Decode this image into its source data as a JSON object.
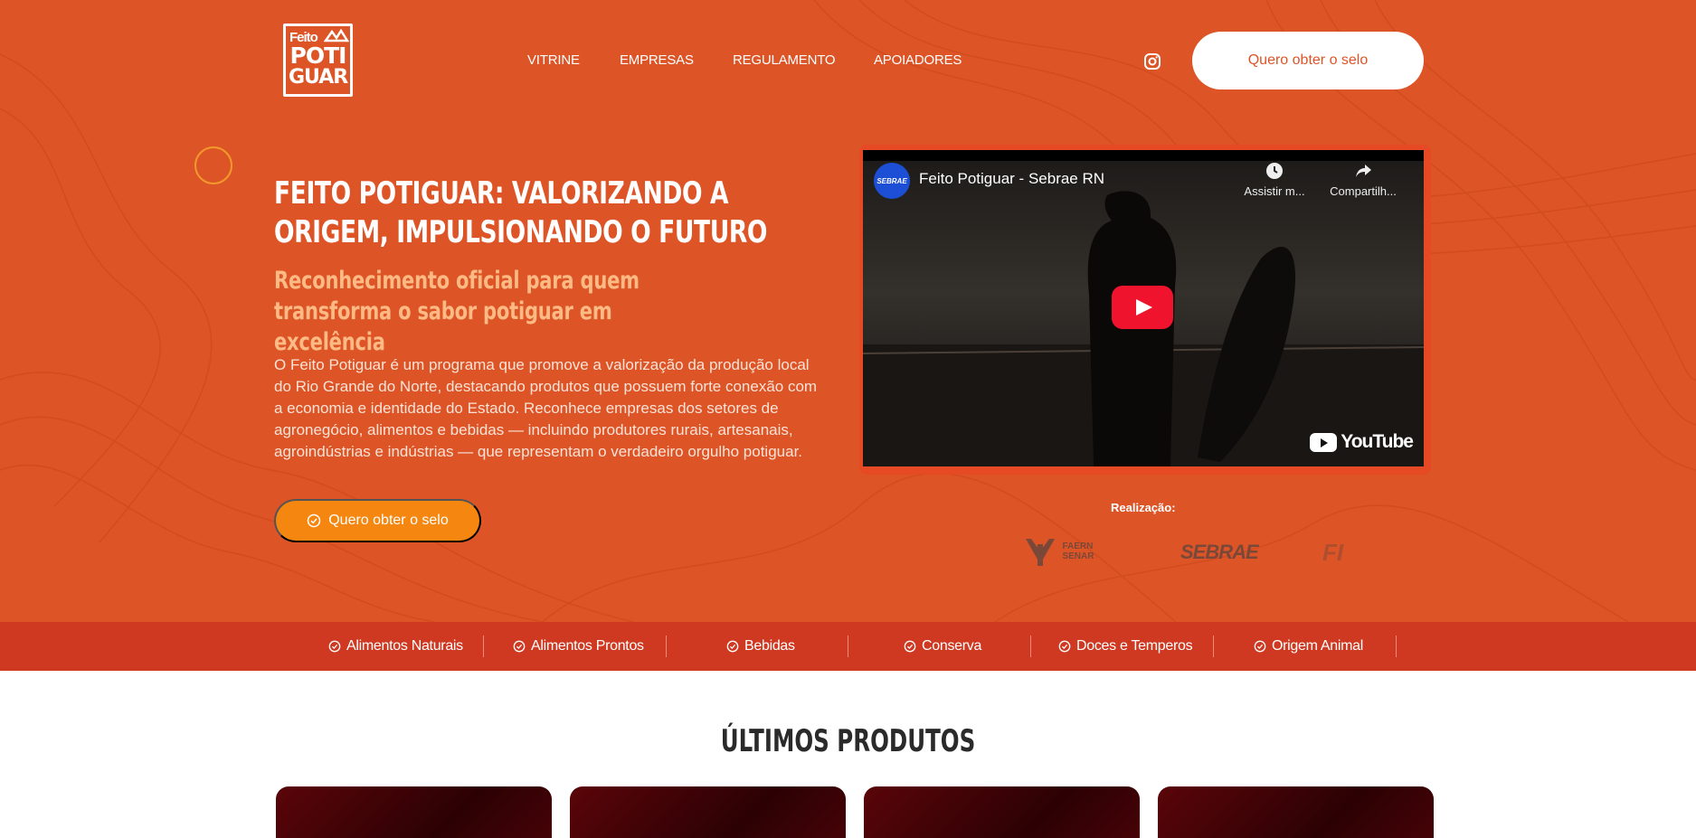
{
  "header": {
    "logo": {
      "line1": "Feito",
      "line2": "POTI",
      "line3": "GUAR"
    },
    "nav": [
      "VITRINE",
      "EMPRESAS",
      "REGULAMENTO",
      "APOIADORES"
    ],
    "cta_label": "Quero obter o selo"
  },
  "hero": {
    "title": "FEITO POTIGUAR: VALORIZANDO A ORIGEM, IMPULSIONANDO O FUTURO",
    "subtitle": "Reconhecimento oficial para quem transforma o sabor potiguar em excelência",
    "description": "O Feito Potiguar é um programa que promove a valorização da produção local do Rio Grande do Norte, destacando produtos que possuem forte conexão com a economia e identidade do Estado. Reconhece empresas dos setores de agronegócio, alimentos e bebidas — incluindo produtores rurais, artesanais, agroindústrias e indústrias — que representam o verdadeiro orgulho potiguar.",
    "cta_label": "Quero obter o selo"
  },
  "video": {
    "channel_avatar": "SEBRAE",
    "title": "Feito Potiguar - Sebrae RN",
    "watch_later": "Assistir m...",
    "share": "Compartilh...",
    "brand": "YouTube"
  },
  "realizacao": {
    "label": "Realização:",
    "partners": [
      "FAERN SENAR",
      "SEBRAE",
      "FI"
    ]
  },
  "categories": [
    "Alimentos Naturais",
    "Alimentos Prontos",
    "Bebidas",
    "Conserva",
    "Doces e Temperos",
    "Origem Animal"
  ],
  "section": {
    "title": "ÚLTIMOS PRODUTOS"
  },
  "colors": {
    "primary": "#dd5426",
    "bar": "#cf3921",
    "accent": "#f5860f",
    "subtitle": "#fdba85"
  }
}
